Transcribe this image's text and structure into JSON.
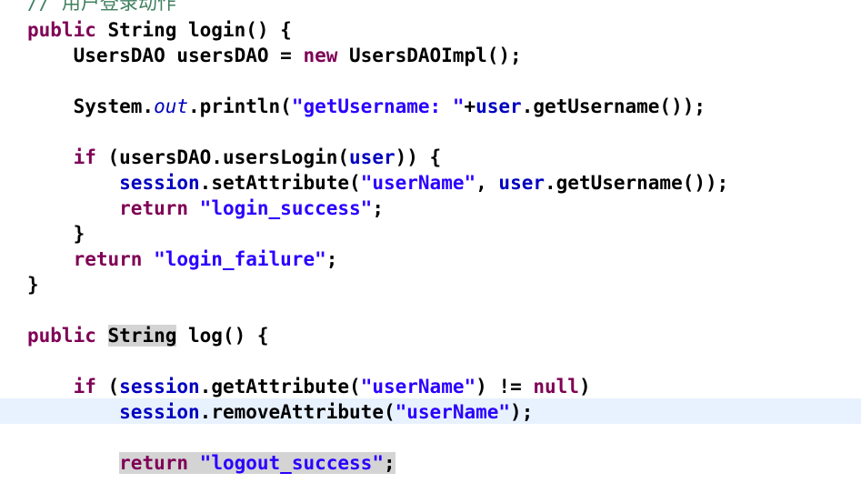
{
  "editor": {
    "comment_line": "// 用户登录动作",
    "lines": {
      "l1": [
        "public",
        " String login() {"
      ],
      "l2": [
        "    UsersDAO usersDAO = ",
        "new",
        " UsersDAOImpl();"
      ],
      "l4": [
        "    System.",
        "out",
        ".println(",
        "\"getUsername: \"",
        "+",
        "user",
        ".getUsername());"
      ],
      "l6": [
        "    ",
        "if",
        " (usersDAO.usersLogin(",
        "user",
        ")) {"
      ],
      "l7": [
        "        ",
        "session",
        ".setAttribute(",
        "\"userName\"",
        ", ",
        "user",
        ".getUsername());"
      ],
      "l8": [
        "        ",
        "return",
        " ",
        "\"login_success\"",
        ";"
      ],
      "l9": [
        "    }"
      ],
      "l10": [
        "    ",
        "return",
        " ",
        "\"login_failure\"",
        ";"
      ],
      "l11": [
        "}"
      ],
      "l13": [
        "public",
        " ",
        "String",
        " log() {"
      ],
      "l15": [
        "    ",
        "if",
        " (",
        "session",
        ".getAttribute(",
        "\"userName\"",
        ") != ",
        "null",
        ")"
      ],
      "l16": [
        "        ",
        "session",
        ".removeAttribute(",
        "\"userName\"",
        ");"
      ],
      "l18": [
        "        ",
        "return",
        " ",
        "\"logout_success\"",
        ";"
      ]
    }
  },
  "colors": {
    "keyword": "#7f0055",
    "string": "#2a00ff",
    "field": "#0000c0",
    "comment": "#3f7f5f",
    "current_line": "#e8f2fe",
    "occurrence_highlight": "#d4d4d4"
  }
}
